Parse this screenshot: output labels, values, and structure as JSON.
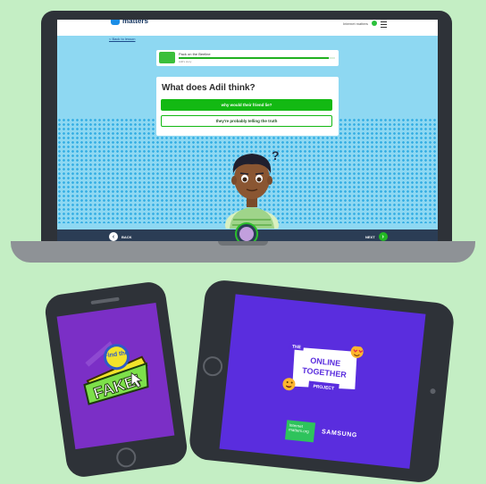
{
  "laptop": {
    "site": {
      "logo_text": "matters",
      "header_link": "Internet matters"
    },
    "back_link": "< Back to lesson",
    "progress": {
      "title": "Pack on the Beeline",
      "subtitle": "Adil's story",
      "fraction": 0.96
    },
    "question": "What does Adil think?",
    "answers": [
      "why would their friend lie?",
      "they're probably telling the truth"
    ],
    "character_mark": "?",
    "nav": {
      "back_label": "BACK",
      "next_label": "NEXT",
      "back_glyph": "‹",
      "next_glyph": "›"
    }
  },
  "phone": {
    "logo_line1": "Find the",
    "logo_line2": "FAKE!"
  },
  "tablet": {
    "badge": {
      "the": "THE",
      "line1": "ONLINE",
      "line2": "TOGETHER",
      "project": "PROJECT"
    },
    "sponsors": {
      "im_line1": "Internet",
      "im_line2": "matters.org",
      "samsung": "SAMSUNG"
    }
  },
  "colors": {
    "background": "#c4eec4",
    "accent_green": "#13b913",
    "screen_blue": "#8ed8f2",
    "phone_purple": "#7b2fc6",
    "tablet_purple": "#5a2dde",
    "fake_yellow": "#f2e32b"
  },
  "icons": [
    "logo-mark-icon",
    "user-avatar-icon",
    "hamburger-menu-icon",
    "back-arrow-icon",
    "next-arrow-icon",
    "character-avatar-icon",
    "emoji-heart-eyes-icon",
    "emoji-tongue-icon"
  ]
}
